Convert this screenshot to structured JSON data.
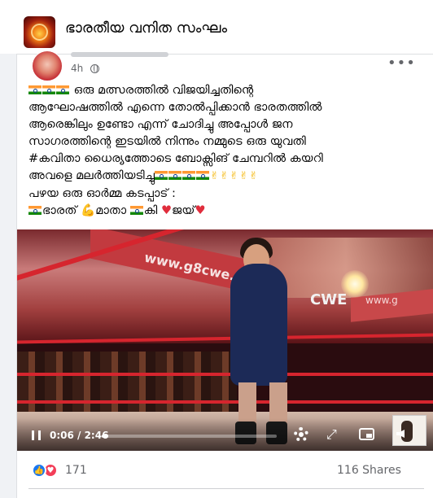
{
  "group": {
    "name": "ഭാരതീയ വനിത സംഘം",
    "avatar_icon": "group-avatar-logo"
  },
  "post": {
    "time": "4h",
    "visibility_icon": "globe-icon",
    "more_icon": "more-options-icon",
    "text_lines": [
      "ഒരു മത്സരത്തിൽ വിജയിച്ചതിന്റെ",
      "ആഘോഷത്തിൽ എന്നെ തോൽപ്പിക്കാൻ ഭാരതത്തിൽ",
      "ആരെങ്കിലും ഉണ്ടോ എന്ന് ചോദിച്ചു അപ്പോൾ ജന",
      "സാഗരത്തിന്റെ ഇടയിൽ നിന്നും നമ്മുടെ ഒരു യുവതി",
      "#കവിതാ ധൈര്യത്തോടെ ബോക്സിങ് ചേമ്പറിൽ കയറി",
      "അവളെ മലർത്തിയടിച്ചു",
      "പഴയ ഒരു ഓർമ്മ കടപ്പാട് :",
      "ഭാരത്",
      "മാതാ",
      "കി",
      "ജയ്"
    ]
  },
  "video": {
    "time_display": "0:06 / 2:46",
    "progress_fraction": 0.036,
    "banner_text": "www.g8cwe.com",
    "ring_text": "CWE",
    "right_banner_text": "www.g"
  },
  "footer": {
    "reaction_count": "171",
    "shares": "116 Shares"
  },
  "colors": {
    "like_blue": "#1877f2",
    "love_red": "#f33e58",
    "secondary_text": "#65676b"
  }
}
